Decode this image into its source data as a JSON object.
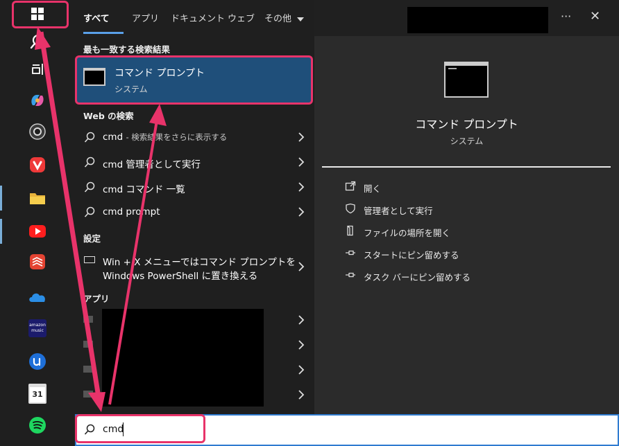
{
  "tabs": [
    {
      "label": "すべて"
    },
    {
      "label": "アプリ"
    },
    {
      "label": "ドキュメント"
    },
    {
      "label": "ウェブ"
    },
    {
      "label": "その他"
    }
  ],
  "sections": {
    "best_match": "最も一致する検索結果",
    "web": "Web の検索",
    "settings": "設定",
    "apps": "アプリ"
  },
  "best_match": {
    "title": "コマンド プロンプト",
    "subtitle": "システム"
  },
  "web_results": [
    {
      "query": "cmd",
      "extra": "- 検索結果をさらに表示する"
    },
    {
      "query": "cmd 管理者として実行",
      "extra": ""
    },
    {
      "query": "cmd コマンド 一覧",
      "extra": ""
    },
    {
      "query": "cmd prompt",
      "extra": ""
    }
  ],
  "settings_result": {
    "line1": "Win + X メニューではコマンド プロンプトを",
    "line2": "Windows PowerShell に置き換える"
  },
  "preview": {
    "title": "コマンド プロンプト",
    "subtitle": "システム",
    "actions": [
      {
        "label": "開く",
        "icon": "open-icon"
      },
      {
        "label": "管理者として実行",
        "icon": "shield-icon"
      },
      {
        "label": "ファイルの場所を開く",
        "icon": "file-location-icon"
      },
      {
        "label": "スタートにピン留めする",
        "icon": "pin-icon"
      },
      {
        "label": "タスク バーにピン留めする",
        "icon": "pin-icon"
      }
    ]
  },
  "search": {
    "value": "cmd"
  },
  "header": {
    "more": "···",
    "close": "✕"
  },
  "taskbar_apps": [
    "start",
    "search",
    "task-view",
    "copilot",
    "obs",
    "vivaldi",
    "file-explorer",
    "youtube",
    "todoist",
    "onedrive",
    "amazon-music",
    "app-u",
    "calendar",
    "spotify"
  ],
  "amazon_music": {
    "line1": "amazon",
    "line2": "music"
  },
  "calendar_day": "31",
  "colors": {
    "accent": "#1f4f7a",
    "highlight": "#e8336a",
    "underline": "#5aa0e8"
  }
}
